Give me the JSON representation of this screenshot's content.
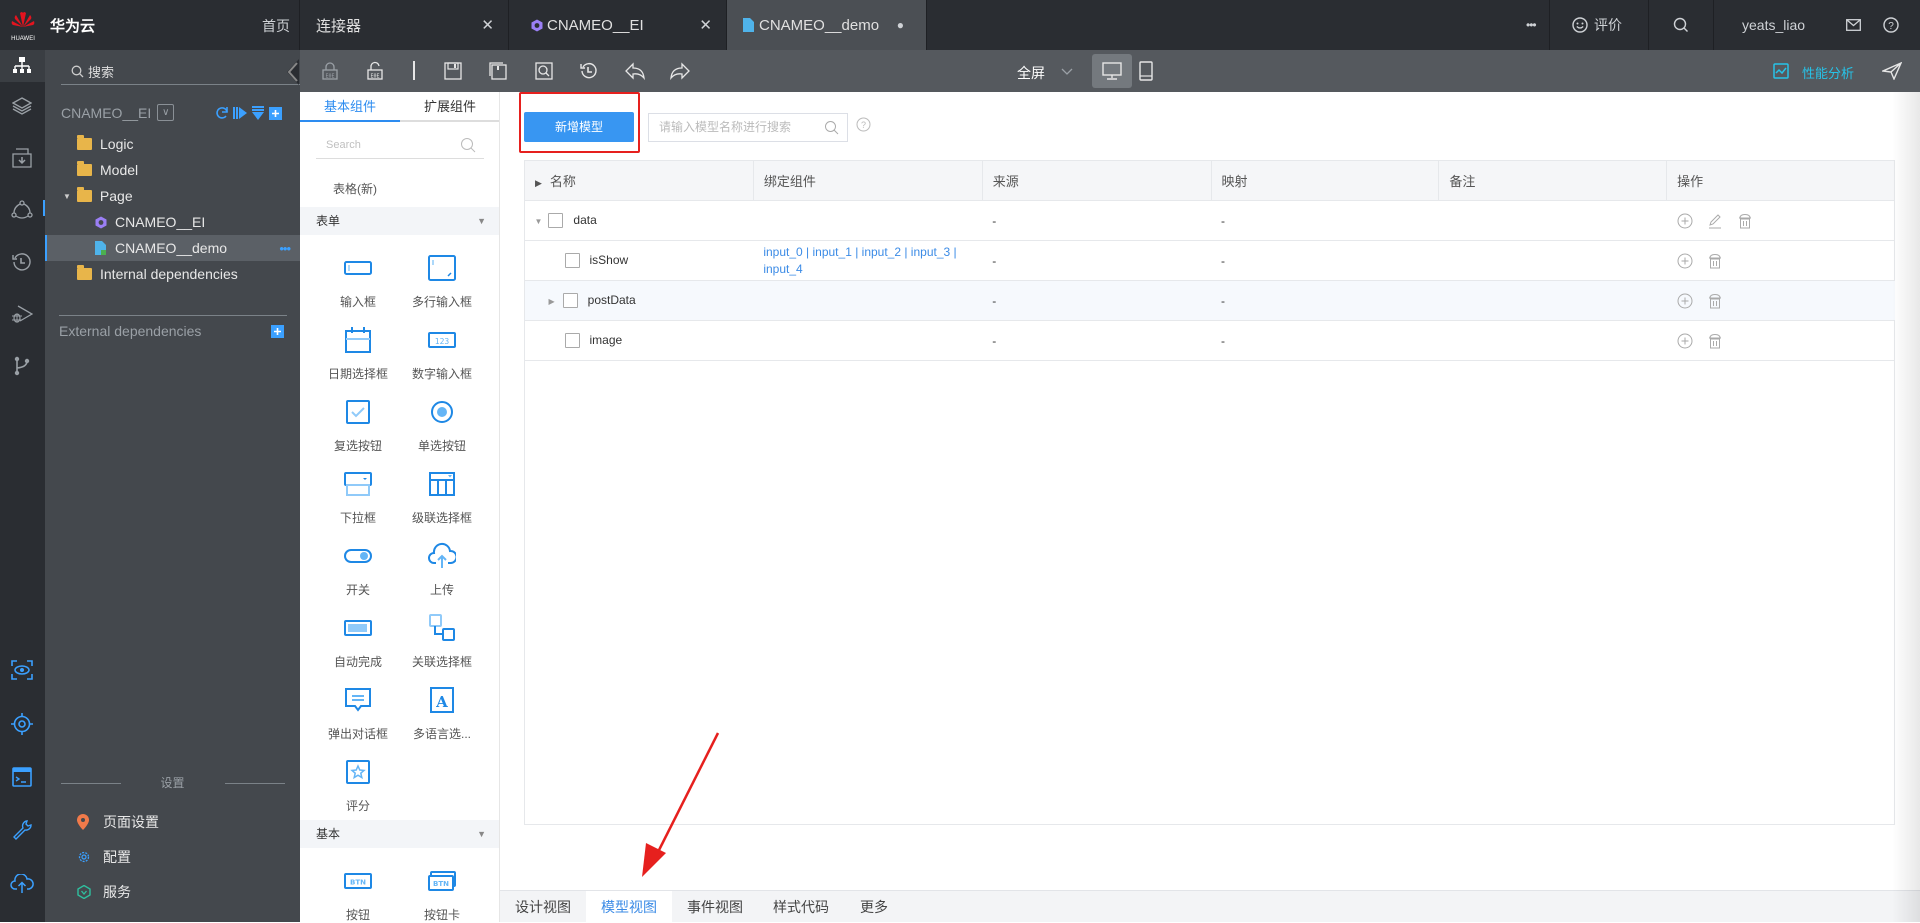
{
  "topbar": {
    "brand": "华为云",
    "logo_text": "HUAWEI",
    "home": "首页",
    "tabs": [
      {
        "label": "连接器",
        "closable": true,
        "icon": "none"
      },
      {
        "label": "CNAMEO__EI",
        "closable": true,
        "icon": "purple-hexagon-icon"
      },
      {
        "label": "CNAMEO__demo",
        "closable": false,
        "modified": true,
        "icon": "file-icon",
        "active": true
      }
    ],
    "more": "•••",
    "feedback": "评价",
    "user": "yeats_liao"
  },
  "sidebar": {
    "search_placeholder": "搜索",
    "project": "CNAMEO__EI",
    "tree": [
      {
        "label": "Logic",
        "type": "folder",
        "level": 0
      },
      {
        "label": "Model",
        "type": "folder",
        "level": 0
      },
      {
        "label": "Page",
        "type": "folder",
        "level": 0,
        "expanded": true
      },
      {
        "label": "CNAMEO__EI",
        "type": "component",
        "level": 1
      },
      {
        "label": "CNAMEO__demo",
        "type": "page",
        "level": 1,
        "selected": true
      },
      {
        "label": "Internal dependencies",
        "type": "folder",
        "level": 0
      }
    ],
    "external": "External dependencies",
    "settings_title": "设置",
    "settings": [
      {
        "label": "页面设置",
        "icon": "location-pin-icon"
      },
      {
        "label": "配置",
        "icon": "gear-icon"
      },
      {
        "label": "服务",
        "icon": "service-icon"
      }
    ]
  },
  "toolbar": {
    "screen_mode": "全屏",
    "perf": "性能分析"
  },
  "components": {
    "tabs": [
      "基本组件",
      "扩展组件"
    ],
    "search_placeholder": "Search",
    "table_new": "表格(新)",
    "groups": [
      {
        "title": "表单",
        "items": [
          "输入框",
          "多行输入框",
          "日期选择框",
          "数字输入框",
          "复选按钮",
          "单选按钮",
          "下拉框",
          "级联选择框",
          "开关",
          "上传",
          "自动完成",
          "关联选择框",
          "弹出对话框",
          "多语言选...",
          "评分"
        ]
      },
      {
        "title": "基本",
        "items": [
          "按钮",
          "按钮卡"
        ]
      }
    ]
  },
  "main": {
    "add_model": "新增模型",
    "search_placeholder": "请输入模型名称进行搜索",
    "columns": [
      "名称",
      "绑定组件",
      "来源",
      "映射",
      "备注",
      "操作"
    ],
    "rows": [
      {
        "name": "data",
        "level": 0,
        "expand": "expanded",
        "binding": "",
        "source": "-",
        "mapping": "-",
        "note": "",
        "ops": [
          "add",
          "edit",
          "delete"
        ]
      },
      {
        "name": "isShow",
        "level": 1,
        "expand": "none",
        "binding": "input_0 | input_1 | input_2 | input_3 | input_4",
        "source": "-",
        "mapping": "-",
        "note": "",
        "ops": [
          "add",
          "delete"
        ]
      },
      {
        "name": "postData",
        "level": 1,
        "expand": "collapsed",
        "binding": "",
        "source": "-",
        "mapping": "-",
        "note": "",
        "ops": [
          "add",
          "delete"
        ],
        "highlighted": true
      },
      {
        "name": "image",
        "level": 1,
        "expand": "none",
        "binding": "",
        "source": "-",
        "mapping": "-",
        "note": "",
        "ops": [
          "add",
          "delete"
        ]
      }
    ]
  },
  "bottom_tabs": [
    {
      "label": "设计视图",
      "active": false
    },
    {
      "label": "模型视图",
      "active": true
    },
    {
      "label": "事件视图",
      "active": false
    },
    {
      "label": "样式代码",
      "active": false
    },
    {
      "label": "更多",
      "active": false
    }
  ],
  "colors": {
    "accent": "#3896f2",
    "highlight_box": "#e6201e",
    "annotation_arrow": "#e6201e"
  }
}
